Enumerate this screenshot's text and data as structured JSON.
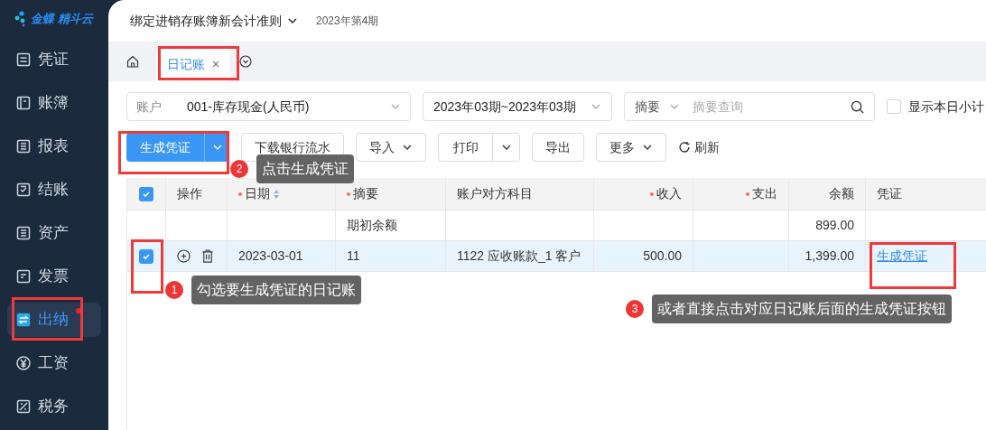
{
  "logo": {
    "text": "金蝶 精斗云"
  },
  "sidebar": {
    "items": [
      {
        "label": "凭证",
        "selected": false,
        "badge": false
      },
      {
        "label": "账簿",
        "selected": false,
        "badge": false
      },
      {
        "label": "报表",
        "selected": false,
        "badge": false
      },
      {
        "label": "结账",
        "selected": false,
        "badge": false
      },
      {
        "label": "资产",
        "selected": false,
        "badge": false
      },
      {
        "label": "发票",
        "selected": false,
        "badge": false
      },
      {
        "label": "出纳",
        "selected": true,
        "badge": true
      },
      {
        "label": "工资",
        "selected": false,
        "badge": false
      },
      {
        "label": "税务",
        "selected": false,
        "badge": false
      }
    ]
  },
  "header": {
    "book": "绑定进销存账簿新会计准则",
    "period": "2023年第4期"
  },
  "tabs": [
    {
      "label": "日记账",
      "close": "×",
      "selected": true
    }
  ],
  "filters": {
    "account": {
      "label": "账户",
      "value": "001-库存现金(人民币)"
    },
    "period": {
      "value": "2023年03期~2023年03期"
    },
    "search": {
      "field": "摘要",
      "placeholder": "摘要查询"
    },
    "daily_subtotal": {
      "label": "显示本日小计",
      "checked": false
    }
  },
  "toolbar": [
    {
      "kind": "primary-split",
      "label": "生成凭证"
    },
    {
      "kind": "plain",
      "label": "下载银行流水"
    },
    {
      "kind": "dropdown",
      "label": "导入"
    },
    {
      "kind": "split",
      "label": "打印"
    },
    {
      "kind": "plain",
      "label": "导出"
    },
    {
      "kind": "dropdown",
      "label": "更多"
    },
    {
      "kind": "refresh",
      "label": "刷新"
    }
  ],
  "table": {
    "all_checked": true,
    "columns": [
      {
        "label": "操作",
        "required": false,
        "sortable": false
      },
      {
        "label": "日期",
        "required": true,
        "sortable": true
      },
      {
        "label": "摘要",
        "required": true,
        "sortable": false
      },
      {
        "label": "账户对方科目",
        "required": false,
        "sortable": false
      },
      {
        "label": "收入",
        "required": true,
        "sortable": false
      },
      {
        "label": "支出",
        "required": true,
        "sortable": false
      },
      {
        "label": "余额",
        "required": false,
        "sortable": false
      },
      {
        "label": "凭证",
        "required": false,
        "sortable": false
      }
    ],
    "rows": [
      {
        "kind": "opening",
        "summary": "期初余额",
        "balance": "899.00"
      },
      {
        "kind": "entry",
        "checked": true,
        "selected": true,
        "date": "2023-03-01",
        "summary": "11",
        "account": "1122 应收账款_1 客户",
        "income": "500.00",
        "balance": "1,399.00",
        "voucher_link": "生成凭证"
      }
    ]
  },
  "annotations": [
    {
      "number": "2",
      "text": "点击生成凭证"
    },
    {
      "number": "1",
      "text": "勾选要生成凭证的日记账"
    },
    {
      "number": "3",
      "text": "或者直接点击对应日记账后面的生成凭证按钮"
    }
  ]
}
